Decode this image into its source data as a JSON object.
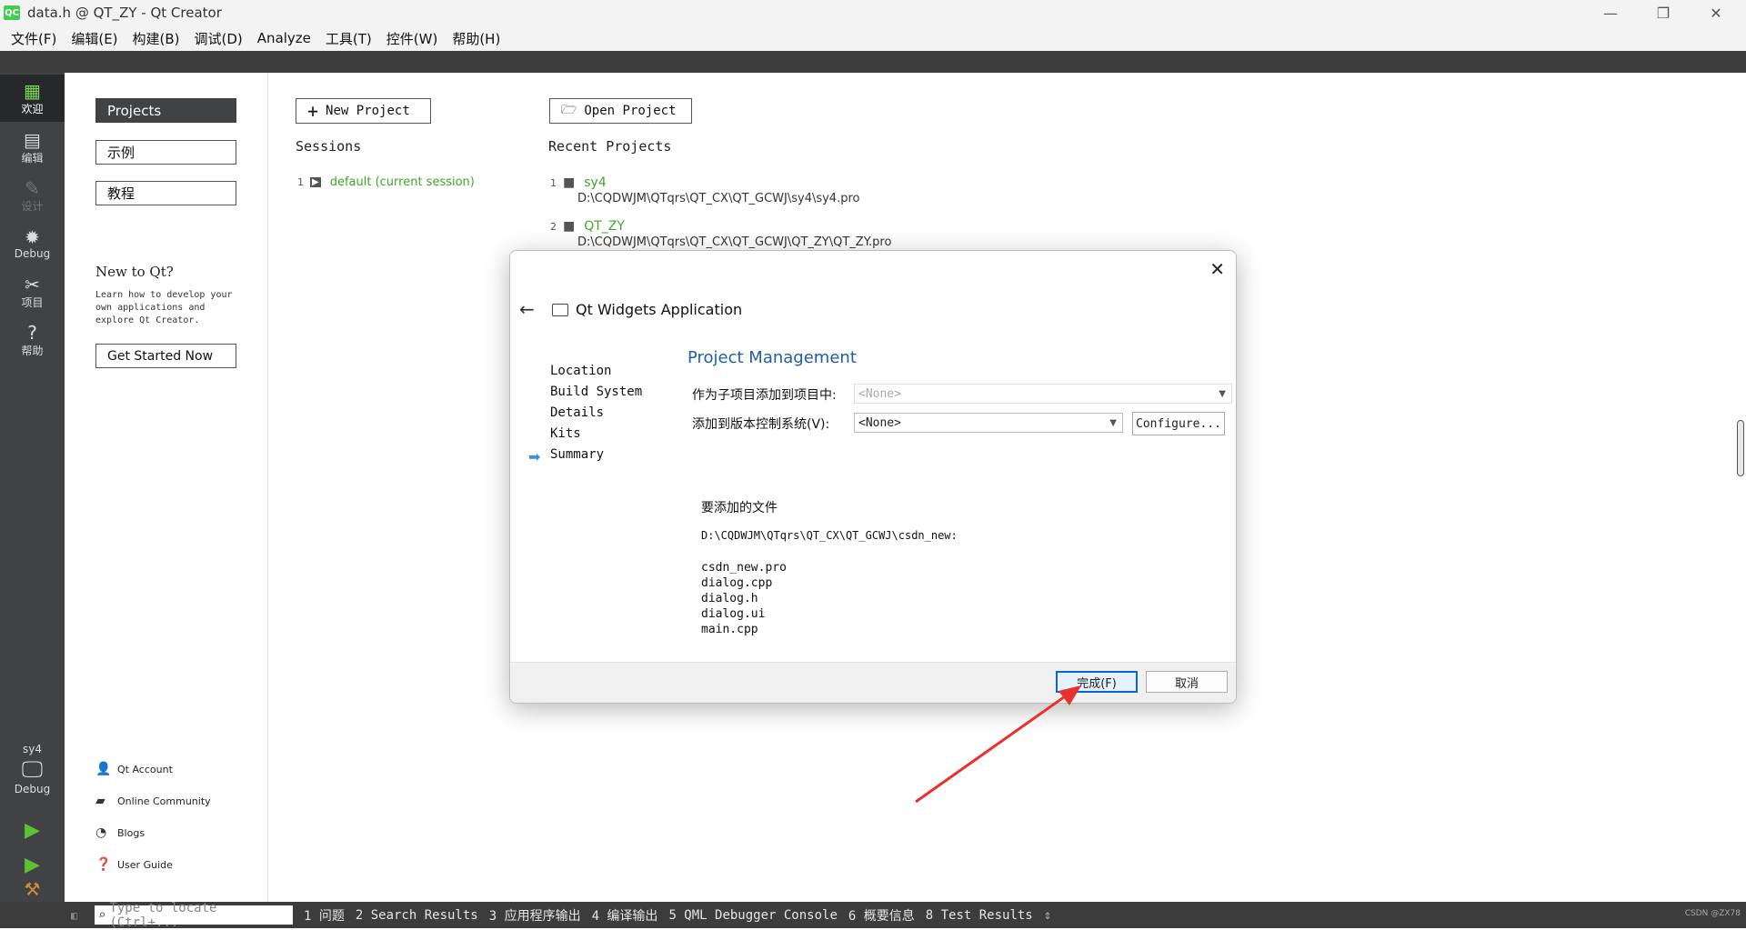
{
  "window": {
    "title": "data.h @ QT_ZY - Qt Creator",
    "app_icon": "QC"
  },
  "menu": [
    "文件(F)",
    "编辑(E)",
    "构建(B)",
    "调试(D)",
    "Analyze",
    "工具(T)",
    "控件(W)",
    "帮助(H)"
  ],
  "modes": {
    "welcome": "欢迎",
    "edit": "编辑",
    "design": "设计",
    "debug": "Debug",
    "projects": "项目",
    "help": "帮助",
    "target_project": "sy4",
    "target_kit": "Debug"
  },
  "welcome": {
    "tabs": [
      "Projects",
      "示例",
      "教程"
    ],
    "new_to_qt": "New to Qt?",
    "new_to_qt_desc": "Learn how to develop your own applications and explore Qt Creator.",
    "get_started": "Get Started Now",
    "links": [
      "Qt Account",
      "Online Community",
      "Blogs",
      "User Guide"
    ],
    "new_project": "New Project",
    "open_project": "Open Project",
    "sessions_heading": "Sessions",
    "recent_heading": "Recent Projects",
    "sessions": [
      {
        "num": "1",
        "name": "default (current session)"
      }
    ],
    "recent": [
      {
        "num": "1",
        "name": "sy4",
        "path": "D:\\CQDWJM\\QTqrs\\QT_CX\\QT_GCWJ\\sy4\\sy4.pro"
      },
      {
        "num": "2",
        "name": "QT_ZY",
        "path": "D:\\CQDWJM\\QTqrs\\QT_CX\\QT_GCWJ\\QT_ZY\\QT_ZY.pro"
      }
    ]
  },
  "dialog": {
    "title": "Qt Widgets Application",
    "steps": [
      "Location",
      "Build System",
      "Details",
      "Kits",
      "Summary"
    ],
    "current_step": "Summary",
    "section_title": "Project Management",
    "subproject_label": "作为子项目添加到项目中:",
    "subproject_value": "<None>",
    "vcs_label": "添加到版本控制系统(V):",
    "vcs_value": "<None>",
    "configure": "Configure...",
    "files_title": "要添加的文件",
    "files_path": "D:\\CQDWJM\\QTqrs\\QT_CX\\QT_GCWJ\\csdn_new:",
    "files": [
      "csdn_new.pro",
      "dialog.cpp",
      "dialog.h",
      "dialog.ui",
      "main.cpp"
    ],
    "finish": "完成(F)",
    "cancel": "取消"
  },
  "statusbar": {
    "locator_placeholder": "Type to locate (Ctrl+...",
    "panes": [
      "1 问题",
      "2 Search Results",
      "3 应用程序输出",
      "4 编译输出",
      "5 QML Debugger Console",
      "6 概要信息",
      "8 Test Results"
    ]
  },
  "watermark": "CSDN @ZX78",
  "colors": {
    "accent_green": "#41a62a",
    "mode_bar": "#404244",
    "dialog_title": "#1f5fa8",
    "annotation_arrow": "#e8312f"
  }
}
